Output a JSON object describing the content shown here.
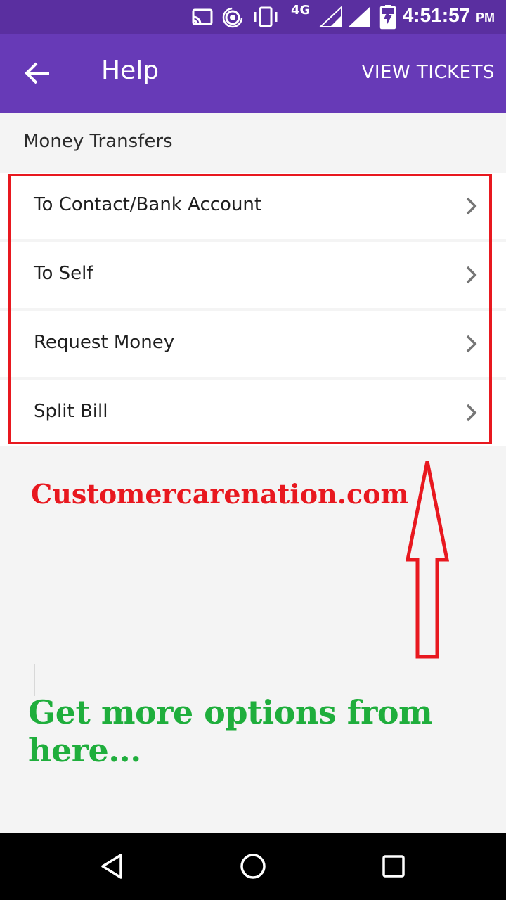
{
  "status_bar": {
    "network_label": "4G",
    "time": "4:51:57",
    "ampm": "PM",
    "icons": [
      "cast-icon",
      "hotspot-icon",
      "vibrate-icon",
      "signal-icon",
      "signal-icon",
      "battery-charging-icon"
    ]
  },
  "app_bar": {
    "title": "Help",
    "action": "VIEW TICKETS",
    "back_icon": "arrow-back-icon",
    "color": "#673ab7"
  },
  "section": {
    "title": "Money Transfers",
    "items": [
      {
        "label": "To Contact/Bank Account"
      },
      {
        "label": "To Self"
      },
      {
        "label": "Request Money"
      },
      {
        "label": "Split Bill"
      }
    ]
  },
  "annotations": {
    "watermark": "Customercarenation.com",
    "caption": "Get more options from here...",
    "highlight_color": "#e8181f",
    "caption_color": "#1fae3c"
  },
  "nav_bar": {
    "buttons": [
      "back-triangle-icon",
      "home-circle-icon",
      "recents-square-icon"
    ]
  }
}
